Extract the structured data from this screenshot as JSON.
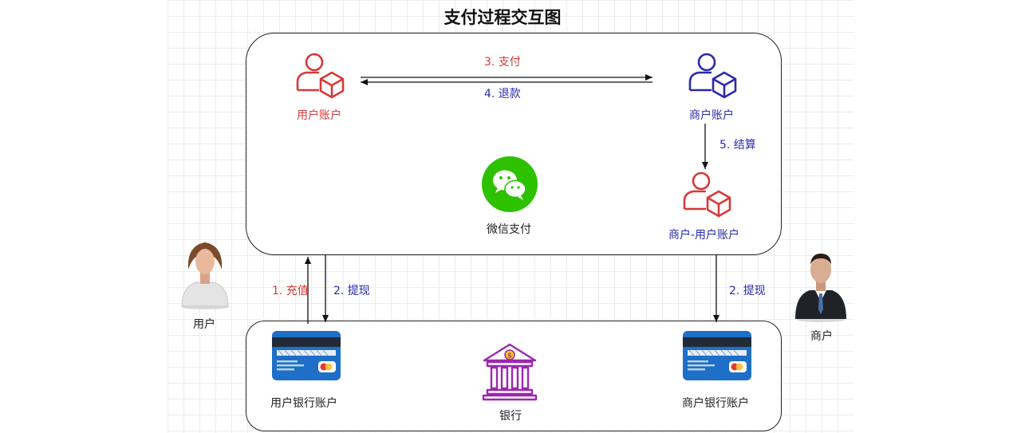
{
  "title": "支付过程交互图",
  "nodes": {
    "user_account": "用户账户",
    "merchant_account": "商户账户",
    "merchant_user_account": "商户-用户账户",
    "wechat_pay": "微信支付",
    "user_bank_account": "用户银行账户",
    "merchant_bank_account": "商户银行账户",
    "bank": "银行",
    "user": "用户",
    "merchant": "商户"
  },
  "edges": {
    "pay": "3. 支付",
    "refund": "4. 退款",
    "settle": "5. 结算",
    "recharge": "1. 充值",
    "withdraw_user": "2. 提现",
    "withdraw_merchant": "2. 提现"
  },
  "colors": {
    "red": "#d63a3a",
    "blue": "#2b2ba8",
    "wechat_green": "#2dc100",
    "bank_purple": "#9c27b0",
    "card_blue": "#1e6fc8"
  }
}
